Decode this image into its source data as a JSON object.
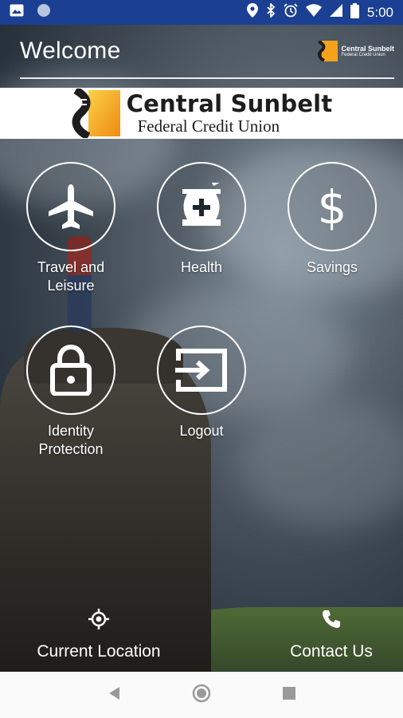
{
  "status_bar": {
    "time": "5:00",
    "icons": [
      "image-icon",
      "circle-icon",
      "location-icon",
      "bluetooth-icon",
      "alarm-icon",
      "wifi-icon",
      "signal-icon",
      "battery-icon"
    ]
  },
  "header": {
    "title": "Welcome",
    "logo_line1": "Central Sunbelt",
    "logo_line2": "Federal Credit Union"
  },
  "banner": {
    "line1": "Central Sunbelt",
    "line2": "Federal Credit Union"
  },
  "menu": [
    {
      "label": "Travel and Leisure",
      "icon": "airplane-icon"
    },
    {
      "label": "Health",
      "icon": "mortar-pestle-icon"
    },
    {
      "label": "Savings",
      "icon": "dollar-icon"
    },
    {
      "label": "Identity Protection",
      "icon": "lock-icon"
    },
    {
      "label": "Logout",
      "icon": "logout-icon"
    }
  ],
  "bottom_actions": {
    "location_label": "Current Location",
    "contact_label": "Contact Us"
  },
  "colors": {
    "status_bar": "#1a3f93",
    "logo_orange": "#f4a21b",
    "white": "#ffffff"
  }
}
